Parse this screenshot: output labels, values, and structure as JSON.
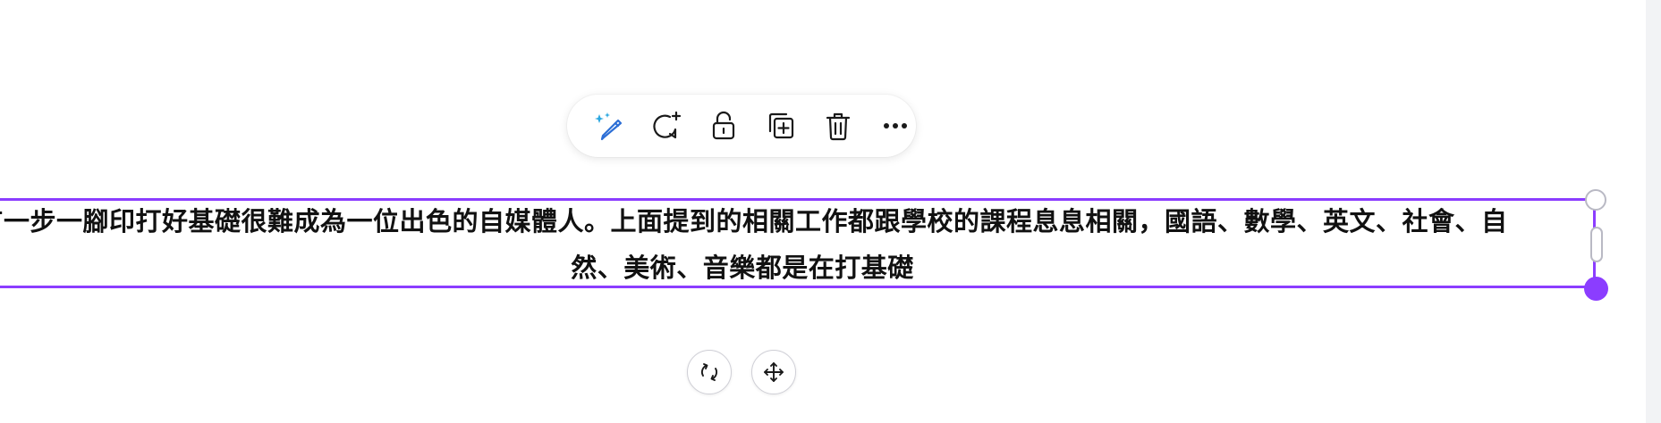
{
  "editor": {
    "text_element": {
      "text": "有一步一腳印打好基礎很難成為一位出色的自媒體人。上面提到的相關工作都跟學校的課程息息相關，國語、數學、英文、社會、自然、美術、音樂都是在打基礎"
    }
  },
  "toolbar": {
    "items": [
      {
        "name": "magic-edit",
        "icon": "magic-pencil-icon"
      },
      {
        "name": "comment",
        "icon": "comment-plus-icon"
      },
      {
        "name": "lock",
        "icon": "unlock-icon"
      },
      {
        "name": "duplicate",
        "icon": "duplicate-icon"
      },
      {
        "name": "delete",
        "icon": "trash-icon"
      },
      {
        "name": "more",
        "icon": "more-horizontal-icon"
      }
    ]
  },
  "controls": {
    "rotate_icon": "rotate-icon",
    "move_icon": "move-icon"
  },
  "colors": {
    "selection": "#8b3dff",
    "magic_icon": "#1f7be0",
    "icon": "#1a1a1a"
  }
}
